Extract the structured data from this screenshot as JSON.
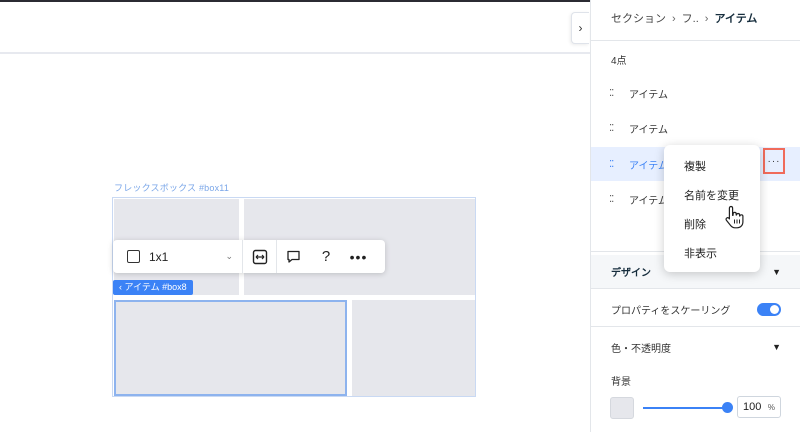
{
  "canvas": {
    "collapse_icon": "chevron-right-icon",
    "flexbox_label": "フレックスボックス #box11",
    "item_tag": "‹ アイテム #box8",
    "toolbar": {
      "size_label": "1x1",
      "icons": [
        "checkbox-icon",
        "chevron-down-icon",
        "fit-icon",
        "comment-icon",
        "help-icon",
        "more-icon"
      ]
    }
  },
  "panel": {
    "breadcrumb": [
      "セクション",
      "フ..",
      "アイテム"
    ],
    "breadcrumb_sep": "›",
    "items_count": "4点",
    "items": [
      {
        "label": "アイテム",
        "selected": false
      },
      {
        "label": "アイテム",
        "selected": false
      },
      {
        "label": "アイテム",
        "selected": true
      },
      {
        "label": "アイテム",
        "selected": false
      }
    ],
    "add_link": "+",
    "design": {
      "title": "デザイン",
      "scale_label": "プロパティをスケーリング",
      "scale_on": true,
      "color_opacity_label": "色・不透明度",
      "background_label": "背景",
      "background_color": "#e6e7ec",
      "opacity_value": "100",
      "opacity_unit": "%"
    }
  },
  "context_menu": {
    "items": [
      "複製",
      "名前を変更",
      "削除",
      "非表示"
    ]
  },
  "colors": {
    "accent": "#3b82f6",
    "highlight_border": "#f06b5b",
    "selected_row_bg": "#e7efff"
  }
}
